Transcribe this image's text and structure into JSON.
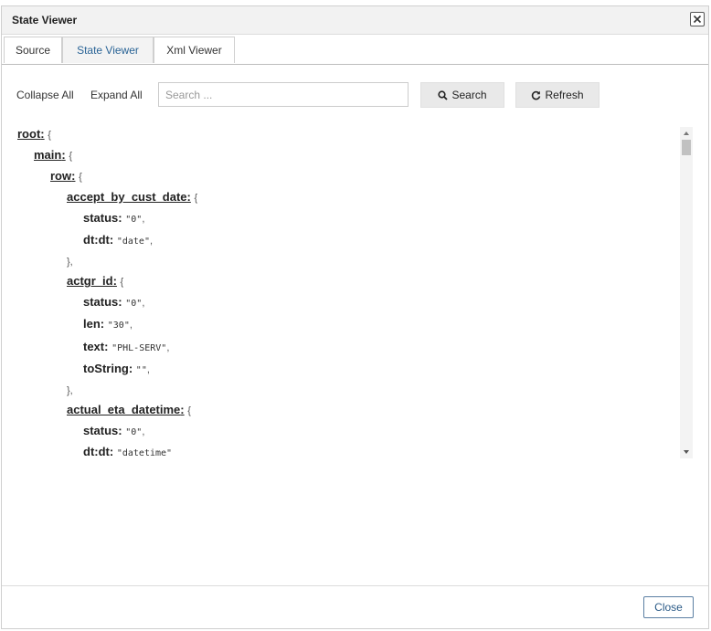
{
  "window": {
    "title": "State Viewer"
  },
  "tabs": [
    {
      "label": "Source",
      "active": false
    },
    {
      "label": "State Viewer",
      "active": true
    },
    {
      "label": "Xml Viewer",
      "active": false
    }
  ],
  "toolbar": {
    "collapse_all": "Collapse All",
    "expand_all": "Expand All",
    "search_placeholder": "Search ...",
    "search_value": "",
    "search_button": "Search",
    "refresh_button": "Refresh"
  },
  "tree": [
    {
      "key": "root",
      "sep": ":",
      "brace": "{",
      "underline": true
    },
    {
      "key": "main",
      "sep": ":",
      "brace": "{",
      "underline": true
    },
    {
      "key": "row",
      "sep": ":",
      "brace": "{",
      "underline": true
    },
    {
      "key": "accept_by_cust_date",
      "sep": ":",
      "brace": "{",
      "underline": true
    },
    {
      "key": "status",
      "sep": ":",
      "value": "\"0\"",
      "trail": ","
    },
    {
      "key": "dt:dt",
      "sep": ":",
      "value": "\"date\"",
      "trail": ","
    },
    {
      "brace": "},"
    },
    {
      "key": "actgr_id",
      "sep": ":",
      "brace": "{",
      "underline": true
    },
    {
      "key": "status",
      "sep": ":",
      "value": "\"0\"",
      "trail": ","
    },
    {
      "key": "len",
      "sep": ":",
      "value": "\"30\"",
      "trail": ","
    },
    {
      "key": "text",
      "sep": ":",
      "value": "\"PHL-SERV\"",
      "trail": ","
    },
    {
      "key": "toString",
      "sep": ":",
      "value": "\"\"",
      "trail": ","
    },
    {
      "brace": "},"
    },
    {
      "key": "actual_eta_datetime",
      "sep": ":",
      "brace": "{",
      "underline": true
    },
    {
      "key": "status",
      "sep": ":",
      "value": "\"0\"",
      "trail": ","
    },
    {
      "key": "dt:dt",
      "sep": ":",
      "value": "\"datetime\"",
      "trail": ""
    }
  ],
  "footer": {
    "close_button": "Close"
  }
}
